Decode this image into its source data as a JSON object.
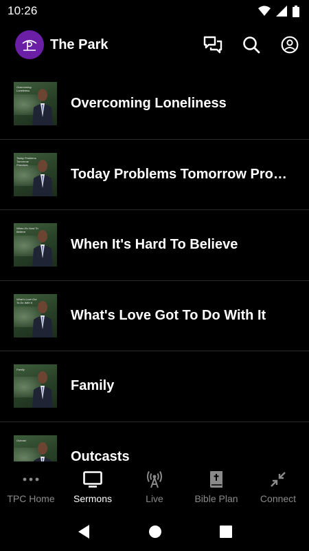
{
  "status_bar": {
    "time": "10:26"
  },
  "app_bar": {
    "title": "The Park"
  },
  "sermons": [
    {
      "title": "Overcoming Loneliness",
      "thumb_text": "Overcoming Loneliness"
    },
    {
      "title": "Today Problems Tomorrow Promises",
      "thumb_text": "Today Problems Tomorrow Promises"
    },
    {
      "title": "When It's Hard To Believe",
      "thumb_text": "When It's Hard To Believe"
    },
    {
      "title": "What's Love Got To Do With It",
      "thumb_text": "What's Love Got To Do With It"
    },
    {
      "title": "Family",
      "thumb_text": "Family"
    },
    {
      "title": "Outcasts",
      "thumb_text": "Outcast"
    }
  ],
  "bottom_nav": [
    {
      "label": "TPC Home",
      "icon": "more-dots-icon",
      "active": false
    },
    {
      "label": "Sermons",
      "icon": "tv-icon",
      "active": true
    },
    {
      "label": "Live",
      "icon": "broadcast-icon",
      "active": false
    },
    {
      "label": "Bible Plan",
      "icon": "bible-icon",
      "active": false
    },
    {
      "label": "Connect",
      "icon": "connect-arrows-icon",
      "active": false
    }
  ],
  "colors": {
    "accent_logo": "#6a1fa6",
    "background": "#000000",
    "inactive_nav": "#8a8a8a"
  }
}
